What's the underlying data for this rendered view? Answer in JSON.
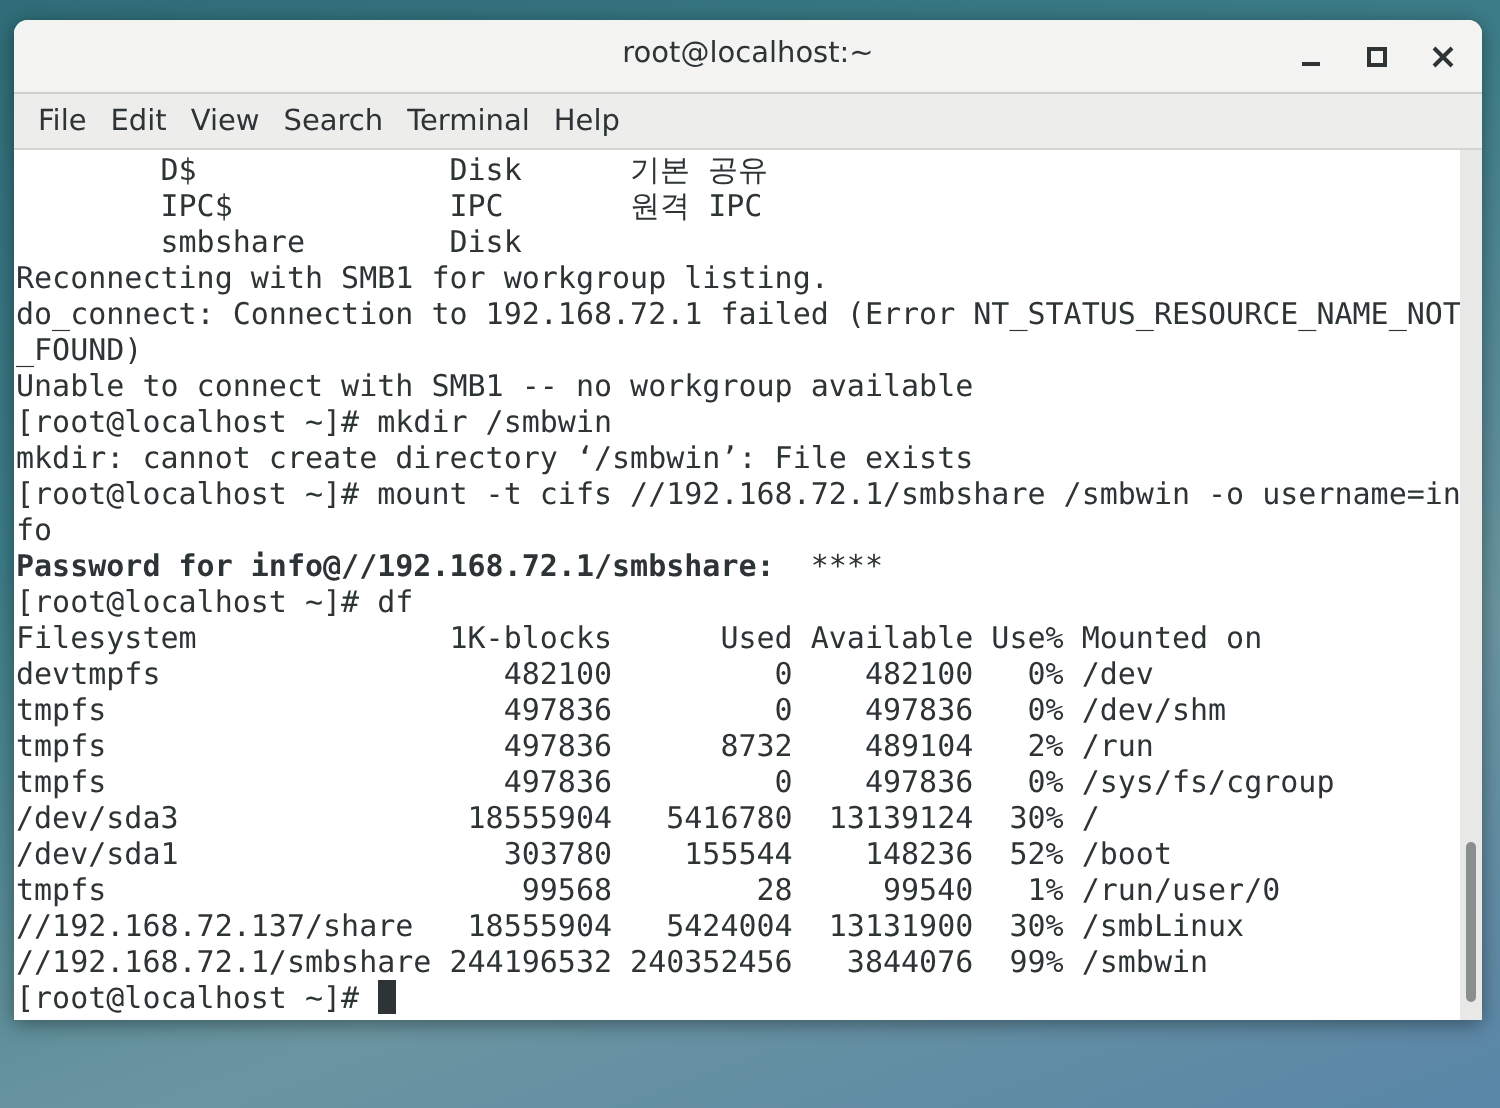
{
  "window": {
    "title": "root@localhost:~"
  },
  "menu": [
    "File",
    "Edit",
    "View",
    "Search",
    "Terminal",
    "Help"
  ],
  "terminal": {
    "lines": [
      "        D$              Disk      기본 공유",
      "        IPC$            IPC       원격 IPC",
      "        smbshare        Disk",
      "Reconnecting with SMB1 for workgroup listing.",
      "do_connect: Connection to 192.168.72.1 failed (Error NT_STATUS_RESOURCE_NAME_NOT",
      "_FOUND)",
      "Unable to connect with SMB1 -- no workgroup available",
      "[root@localhost ~]# mkdir /smbwin",
      "mkdir: cannot create directory ‘/smbwin’: File exists",
      "[root@localhost ~]# mount -t cifs //192.168.72.1/smbshare /smbwin -o username=in",
      "fo",
      "**Password for info@//192.168.72.1/smbshare:**  ****",
      "[root@localhost ~]# df",
      "Filesystem              1K-blocks      Used Available Use% Mounted on",
      "devtmpfs                   482100         0    482100   0% /dev",
      "tmpfs                      497836         0    497836   0% /dev/shm",
      "tmpfs                      497836      8732    489104   2% /run",
      "tmpfs                      497836         0    497836   0% /sys/fs/cgroup",
      "/dev/sda3                18555904   5416780  13139124  30% /",
      "/dev/sda1                  303780    155544    148236  52% /boot",
      "tmpfs                       99568        28     99540   1% /run/user/0",
      "//192.168.72.137/share   18555904   5424004  13131900  30% /smbLinux",
      "//192.168.72.1/smbshare 244196532 240352456   3844076  99% /smbwin"
    ],
    "prompt": "[root@localhost ~]#"
  }
}
